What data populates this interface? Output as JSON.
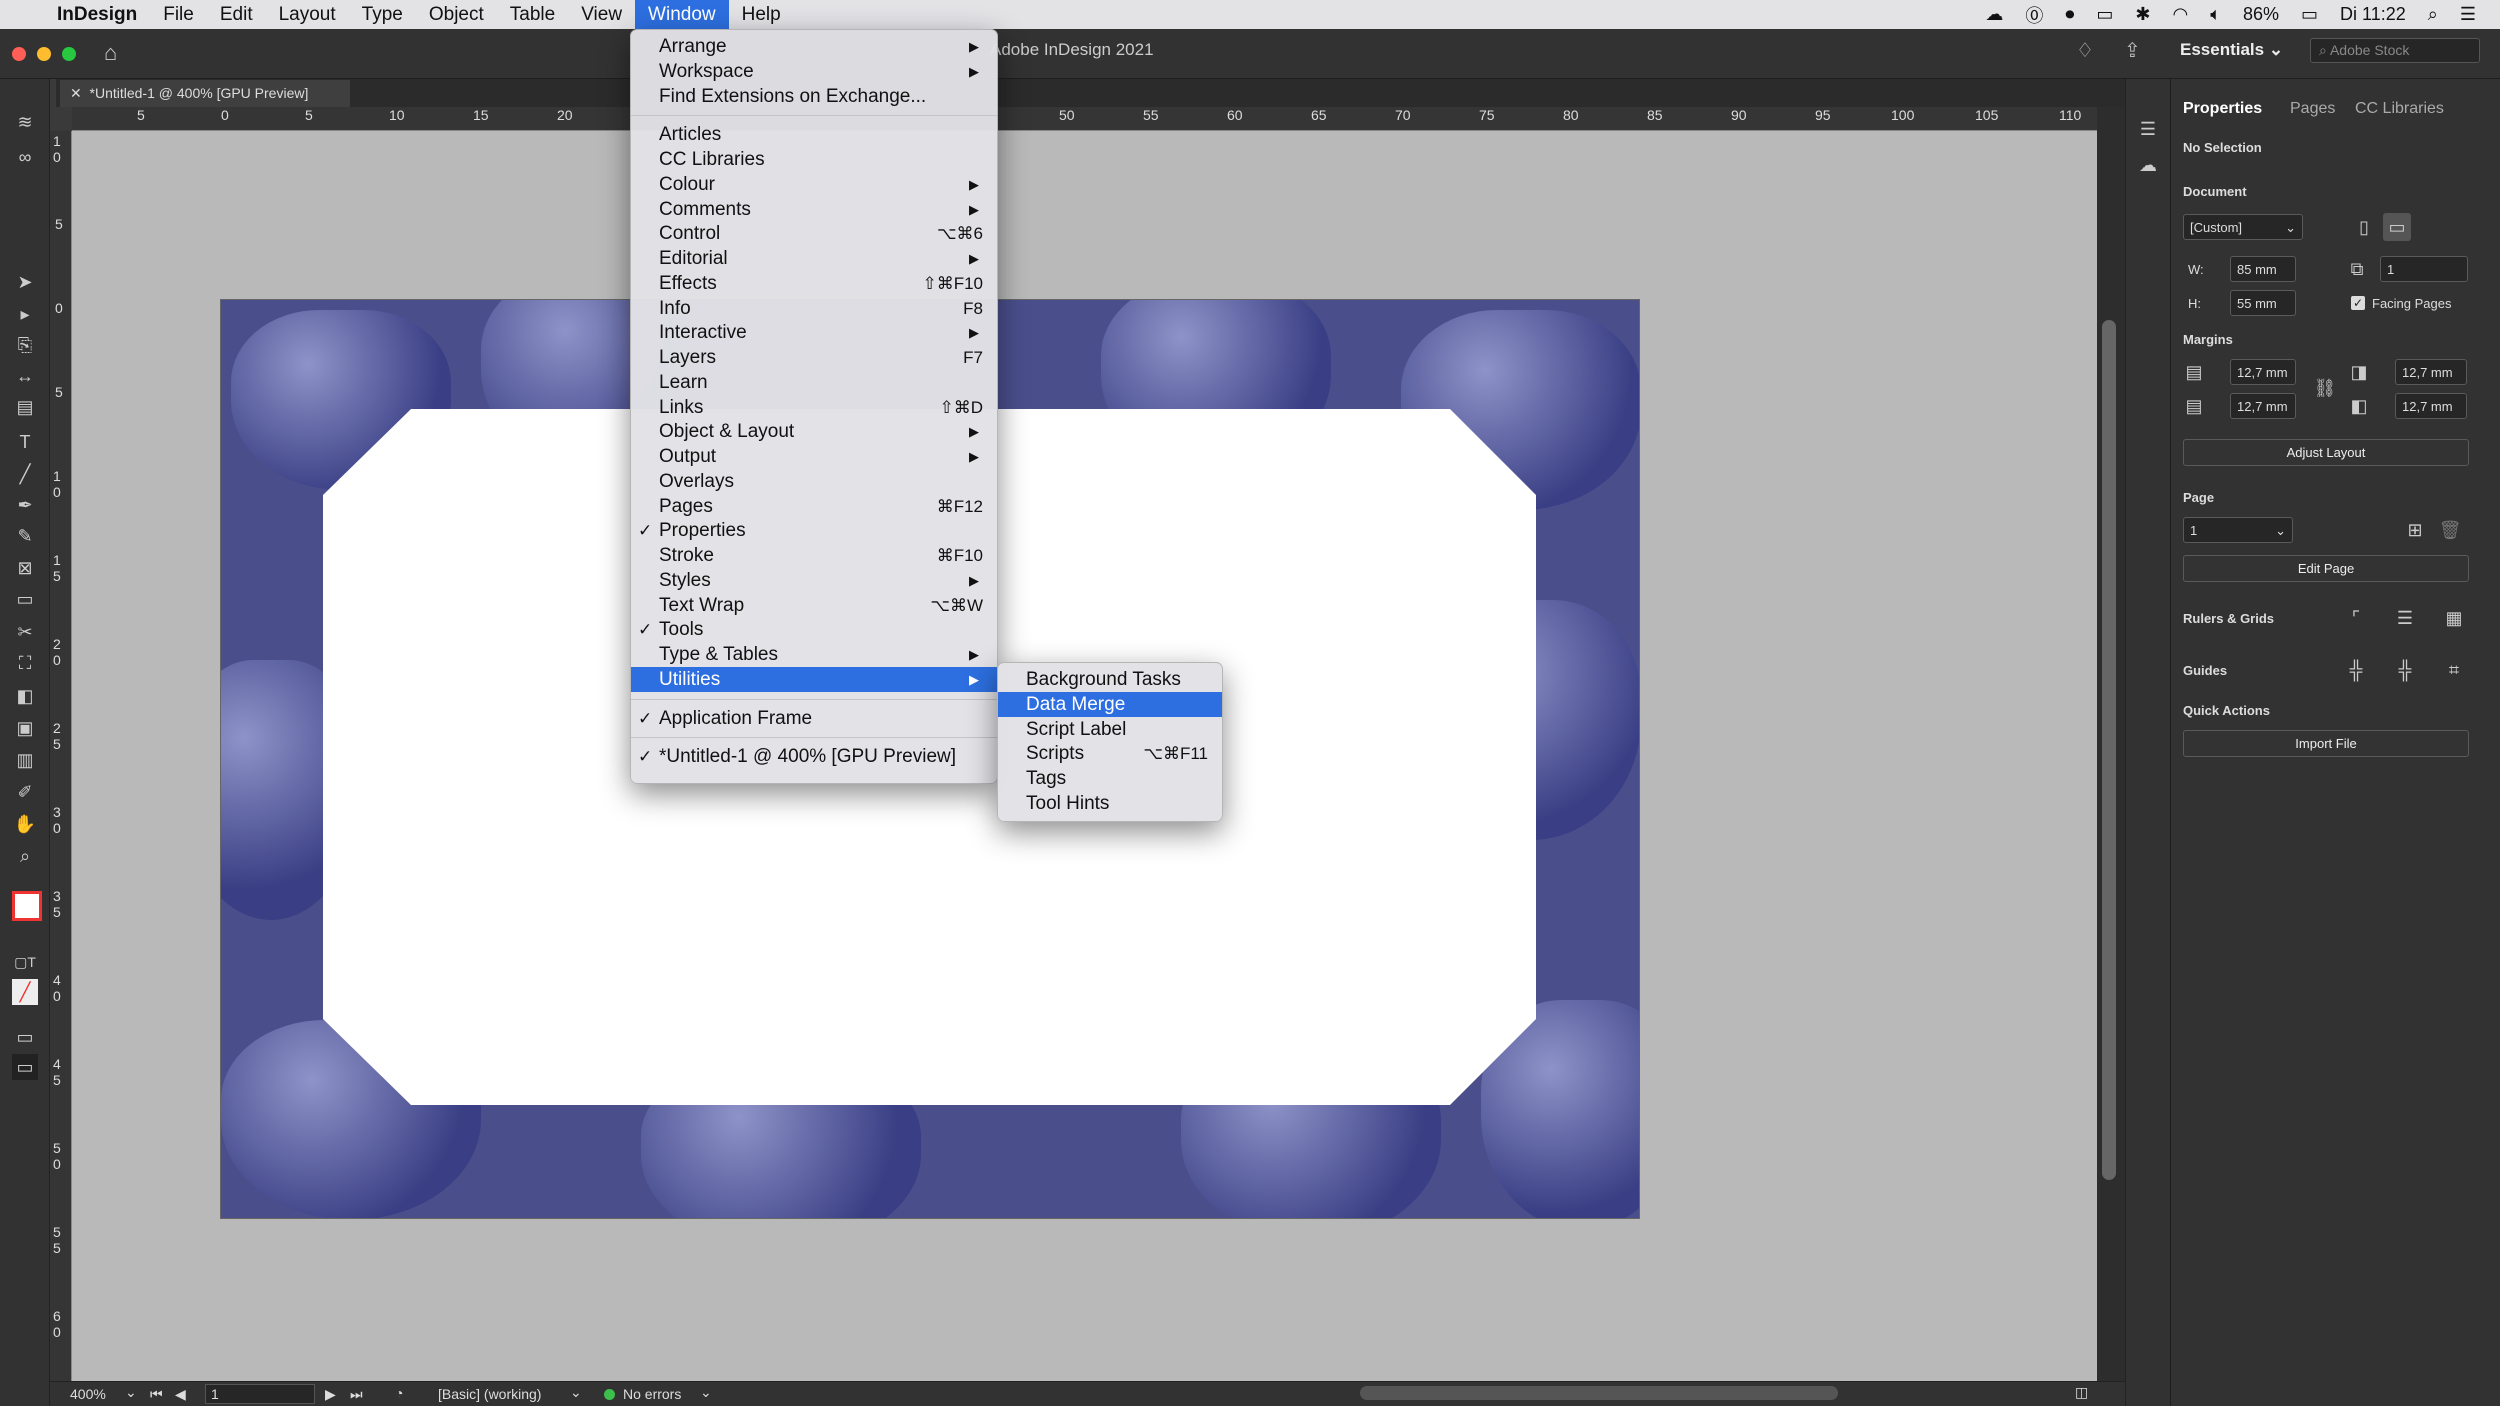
{
  "menubar": {
    "app_name": "InDesign",
    "menus": [
      "File",
      "Edit",
      "Layout",
      "Type",
      "Object",
      "Table",
      "View",
      "Window",
      "Help"
    ],
    "status": {
      "battery": "86%",
      "clock": "Di 11:22"
    }
  },
  "titlebar": {
    "title": "Adobe InDesign 2021",
    "workspace": "Essentials",
    "stock_placeholder": "Adobe Stock"
  },
  "document_tab": {
    "label": "*Untitled-1 @ 400% [GPU Preview]"
  },
  "ruler": {
    "h_ticks": [
      "5",
      "0",
      "5",
      "10",
      "15",
      "20",
      "50",
      "55",
      "60",
      "65",
      "70",
      "75",
      "80",
      "85",
      "90",
      "95",
      "100",
      "105",
      "110"
    ],
    "v_ticks": [
      "1 0",
      "5",
      "0",
      "5",
      "1 0",
      "1 5",
      "2 0",
      "2 5",
      "3 0",
      "3 5",
      "4 0",
      "4 5",
      "5 0",
      "5 5",
      "6 0"
    ]
  },
  "window_menu": {
    "items": [
      {
        "label": "Arrange",
        "submenu": true
      },
      {
        "label": "Workspace",
        "submenu": true
      },
      {
        "label": "Find Extensions on Exchange..."
      },
      {
        "sep": true
      },
      {
        "label": "Articles"
      },
      {
        "label": "CC Libraries"
      },
      {
        "label": "Colour",
        "submenu": true
      },
      {
        "label": "Comments",
        "submenu": true
      },
      {
        "label": "Control",
        "shortcut": "⌥⌘6"
      },
      {
        "label": "Editorial",
        "submenu": true
      },
      {
        "label": "Effects",
        "shortcut": "⇧⌘F10"
      },
      {
        "label": "Info",
        "shortcut": "F8"
      },
      {
        "label": "Interactive",
        "submenu": true
      },
      {
        "label": "Layers",
        "shortcut": "F7"
      },
      {
        "label": "Learn"
      },
      {
        "label": "Links",
        "shortcut": "⇧⌘D"
      },
      {
        "label": "Object & Layout",
        "submenu": true
      },
      {
        "label": "Output",
        "submenu": true
      },
      {
        "label": "Overlays"
      },
      {
        "label": "Pages",
        "shortcut": "⌘F12"
      },
      {
        "label": "Properties",
        "checked": true
      },
      {
        "label": "Stroke",
        "shortcut": "⌘F10"
      },
      {
        "label": "Styles",
        "submenu": true
      },
      {
        "label": "Text Wrap",
        "shortcut": "⌥⌘W"
      },
      {
        "label": "Tools",
        "checked": true
      },
      {
        "label": "Type & Tables",
        "submenu": true
      },
      {
        "label": "Utilities",
        "submenu": true,
        "highlighted": true
      },
      {
        "sep": true
      },
      {
        "label": "Application Frame",
        "checked": true
      },
      {
        "sep": true
      },
      {
        "label": "*Untitled-1 @ 400% [GPU Preview]",
        "checked": true
      }
    ]
  },
  "utilities_menu": {
    "items": [
      {
        "label": "Background Tasks"
      },
      {
        "label": "Data Merge",
        "highlighted": true
      },
      {
        "label": "Script Label"
      },
      {
        "label": "Scripts",
        "shortcut": "⌥⌘F11"
      },
      {
        "label": "Tags"
      },
      {
        "label": "Tool Hints"
      }
    ]
  },
  "properties_panel": {
    "tabs": [
      "Properties",
      "Pages",
      "CC Libraries"
    ],
    "selection": "No Selection",
    "document_label": "Document",
    "preset": "[Custom]",
    "w_label": "W:",
    "h_label": "H:",
    "width": "85 mm",
    "height": "55 mm",
    "pages_count": "1",
    "facing_pages": "Facing Pages",
    "margins_label": "Margins",
    "margin_top": "12,7 mm",
    "margin_bottom": "12,7 mm",
    "margin_inside": "12,7 mm",
    "margin_outside": "12,7 mm",
    "adjust_layout": "Adjust Layout",
    "page_label": "Page",
    "page_value": "1",
    "edit_page": "Edit Page",
    "rulers_grids": "Rulers & Grids",
    "guides": "Guides",
    "quick_actions": "Quick Actions",
    "import_file": "Import File"
  },
  "statusbar": {
    "zoom": "400%",
    "page": "1",
    "style": "[Basic] (working)",
    "preflight": "No errors"
  },
  "colors": {
    "accent": "#2d6fe0",
    "cups": "#4a4f8c",
    "ok": "#3cc04b"
  }
}
